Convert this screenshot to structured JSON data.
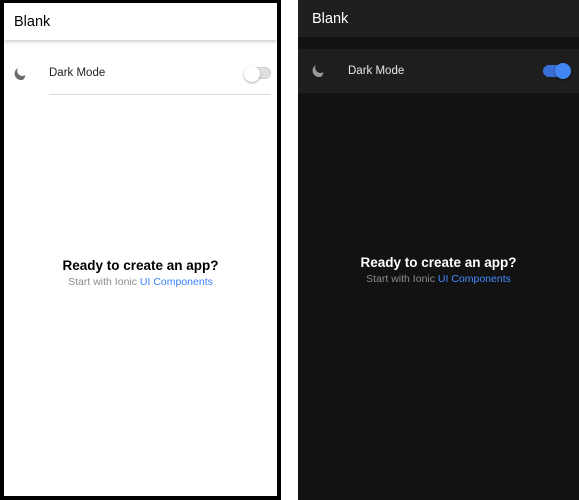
{
  "light": {
    "toolbar": {
      "title": "Blank"
    },
    "setting": {
      "label": "Dark Mode",
      "icon": "moon-icon",
      "enabled": false
    },
    "content": {
      "heading": "Ready to create an app?",
      "subtext_prefix": "Start with Ionic",
      "link_text": "UI Components"
    }
  },
  "dark": {
    "toolbar": {
      "title": "Blank"
    },
    "setting": {
      "label": "Dark Mode",
      "icon": "moon-icon",
      "enabled": true
    },
    "content": {
      "heading": "Ready to create an app?",
      "subtext_prefix": "Start with Ionic",
      "link_text": "UI Components"
    }
  },
  "colors": {
    "accent": "#3880ff",
    "dark_background": "#121212",
    "light_background": "#ffffff"
  }
}
